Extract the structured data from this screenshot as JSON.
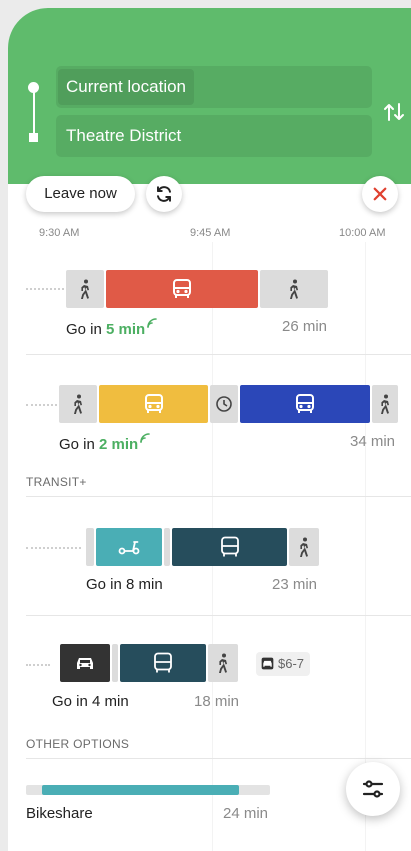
{
  "colors": {
    "header_green": "#5fbb6c",
    "bus_red": "#e05a47",
    "bus_yellow": "#f0bd3f",
    "bus_blue": "#2b47b8",
    "bike_teal": "#4aaeb5",
    "transit_dark_teal": "#264d5c",
    "car_dark": "#333333",
    "live_green": "#4caf62"
  },
  "search": {
    "from": "Current location",
    "to": "Theatre District",
    "swap_icon": "swap-vertical-icon"
  },
  "controls": {
    "leave_label": "Leave now",
    "refresh_icon": "refresh-icon",
    "close_icon": "close-icon"
  },
  "timeline": {
    "labels": [
      "9:30 AM",
      "9:45 AM",
      "10:00 AM"
    ]
  },
  "trips": [
    {
      "go_prefix": "Go in ",
      "go_time": "5 min",
      "duration": "26 min",
      "realtime": true
    },
    {
      "go_prefix": "Go in ",
      "go_time": "2 min",
      "duration": "34 min",
      "realtime": true
    }
  ],
  "transit_plus": {
    "header": "TRANSIT+",
    "trips": [
      {
        "go_text": "Go in 8 min",
        "duration": "23 min"
      },
      {
        "go_text": "Go in 4 min",
        "duration": "18 min",
        "price": "$6-7"
      }
    ]
  },
  "other_options": {
    "header": "OTHER OPTIONS",
    "bikeshare_label": "Bikeshare",
    "bikeshare_duration": "24 min"
  },
  "fab_icon": "filter-sliders-icon"
}
